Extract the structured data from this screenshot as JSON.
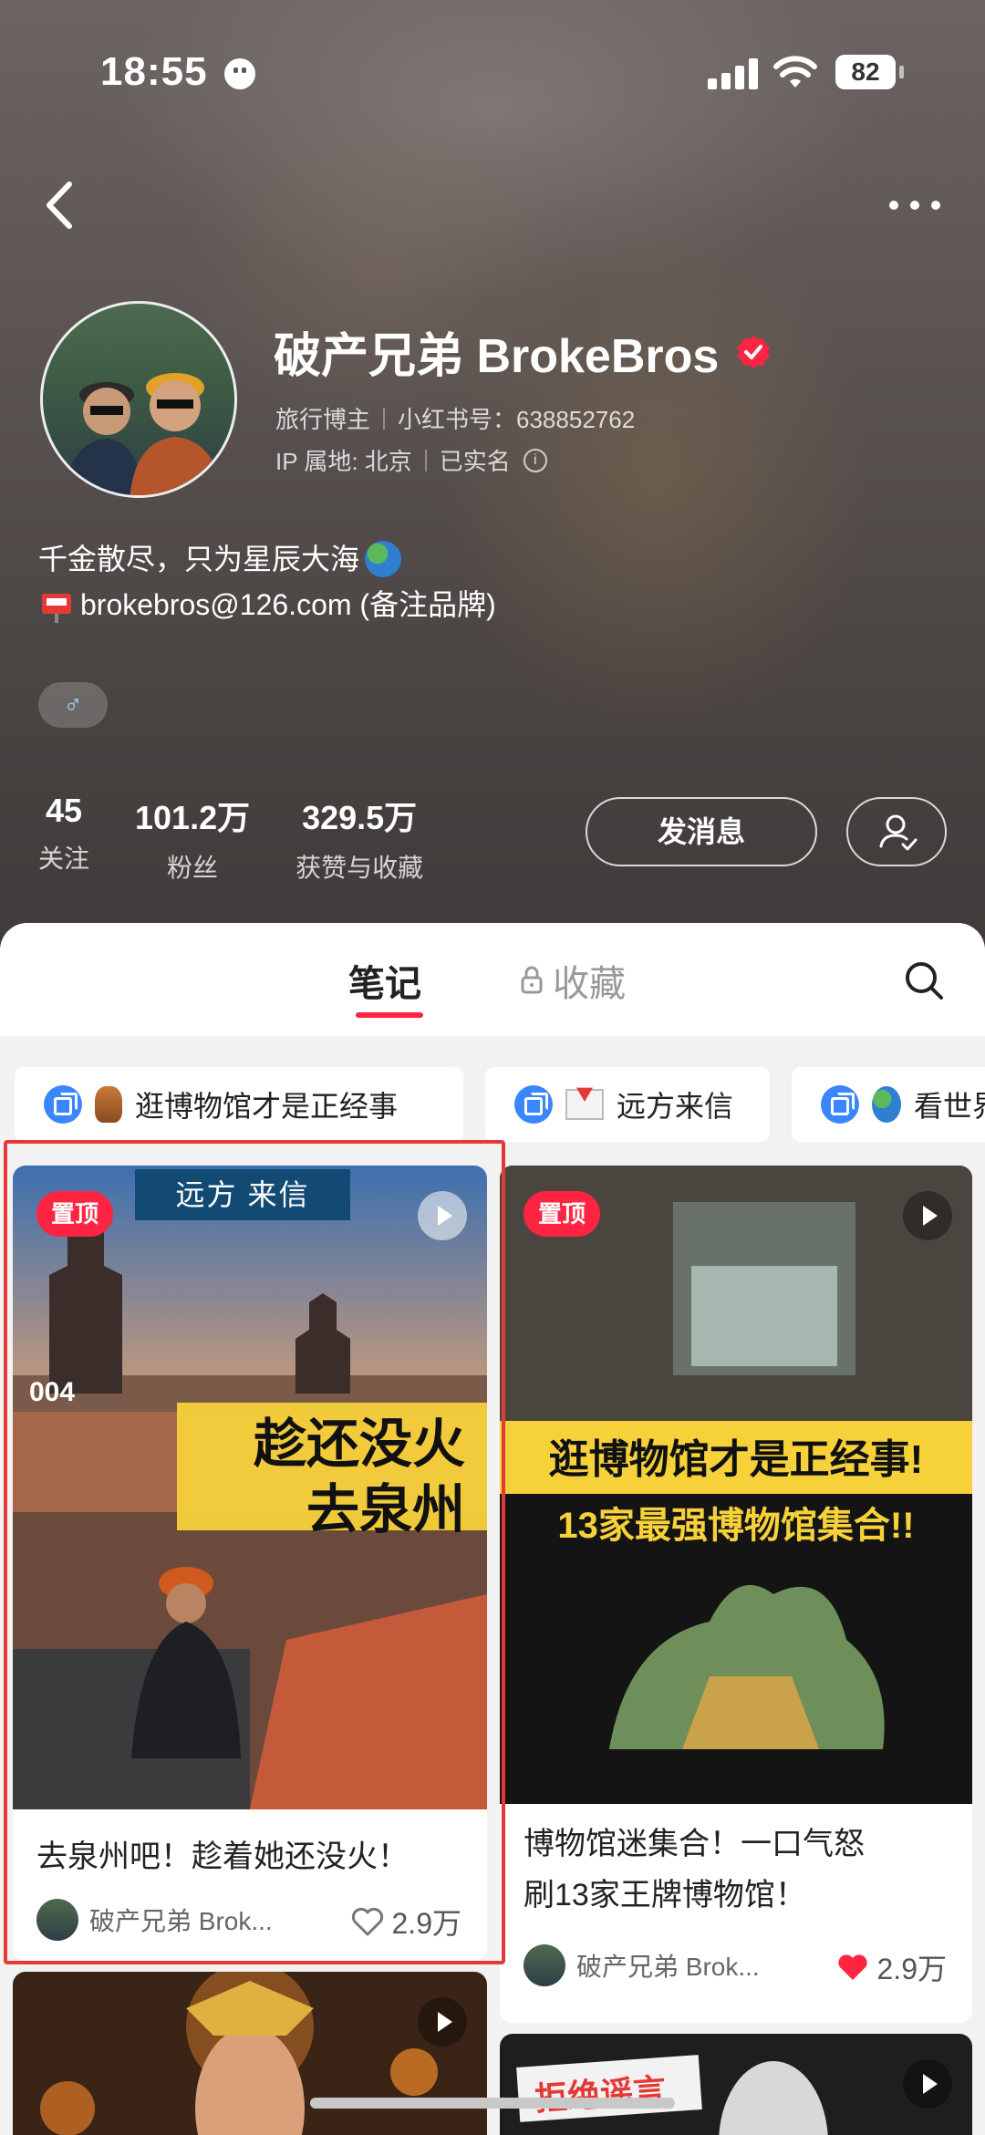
{
  "status": {
    "time": "18:55",
    "battery": "82"
  },
  "profile": {
    "name": "破产兄弟 BrokeBros",
    "category": "旅行博主",
    "red_id": "小红书号：638852762",
    "ip": "IP 属地: 北京",
    "real_name": "已实名",
    "bio_line1": "千金散尽，只为星辰大海",
    "bio_line2": "brokebros@126.com (备注品牌)",
    "gender": "♂"
  },
  "stats": [
    {
      "value": "45",
      "label": "关注"
    },
    {
      "value": "101.2万",
      "label": "粉丝"
    },
    {
      "value": "329.5万",
      "label": "获赞与收藏"
    }
  ],
  "actions": {
    "message": "发消息"
  },
  "tabs": {
    "notes": "笔记",
    "collections": "收藏"
  },
  "collections": [
    {
      "label": "逛博物馆才是正经事"
    },
    {
      "label": "远方来信"
    },
    {
      "label": "看世界"
    }
  ],
  "notes": [
    {
      "pin": "置顶",
      "banner": "远方 来信",
      "episode": "004",
      "overlay_line1": "趁还没火",
      "overlay_line2": "去泉州",
      "title": "去泉州吧！趁着她还没火！",
      "author": "破产兄弟 Brok...",
      "likes": "2.9万"
    },
    {
      "pin": "置顶",
      "overlay_line1": "逛博物馆才是正经事!",
      "overlay_line2": "13家最强博物馆集合!!",
      "title_line1": "博物馆迷集合！一口气怒",
      "title_line2": "刷13家王牌博物馆！",
      "author": "破产兄弟 Brok...",
      "likes": "2.9万"
    },
    {
      "overlay": ""
    },
    {
      "overlay": "拒绝谣言"
    }
  ],
  "colors": {
    "accent": "#ff2442",
    "highlight": "#e53935"
  }
}
